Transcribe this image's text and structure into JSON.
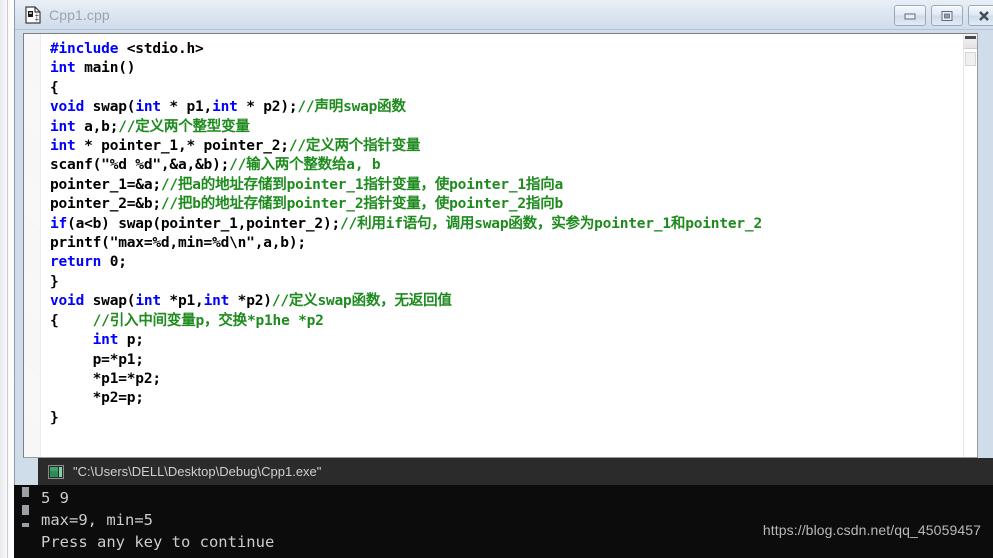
{
  "window": {
    "title": "Cpp1.cpp",
    "doc_icon": "cpp-file-icon",
    "buttons": {
      "minimize_label": "Minimize",
      "restore_label": "Restore",
      "close_label": "Close"
    }
  },
  "colors": {
    "keyword": "#0000ff",
    "comment": "#1e8b1e",
    "plain": "#000000",
    "title_bar_bg": "#dde7f1",
    "console_bg": "#0c0c0c",
    "console_title_bg": "#2b2b2b",
    "watermark": "#b9b9b9"
  },
  "editor": {
    "lines": [
      [
        {
          "t": "kw",
          "s": "#include"
        },
        {
          "t": "pl",
          "s": " <stdio.h>"
        }
      ],
      [
        {
          "t": "kw",
          "s": "int"
        },
        {
          "t": "pl",
          "s": " main()"
        }
      ],
      [
        {
          "t": "pl",
          "s": "{"
        }
      ],
      [
        {
          "t": "kw",
          "s": "void"
        },
        {
          "t": "pl",
          "s": " swap("
        },
        {
          "t": "kw",
          "s": "int"
        },
        {
          "t": "pl",
          "s": " * p1,"
        },
        {
          "t": "kw",
          "s": "int"
        },
        {
          "t": "pl",
          "s": " * p2);"
        },
        {
          "t": "cm",
          "s": "//声明swap函数"
        }
      ],
      [
        {
          "t": "kw",
          "s": "int"
        },
        {
          "t": "pl",
          "s": " a,b;"
        },
        {
          "t": "cm",
          "s": "//定义两个整型变量"
        }
      ],
      [
        {
          "t": "kw",
          "s": "int"
        },
        {
          "t": "pl",
          "s": " * pointer_1,* pointer_2;"
        },
        {
          "t": "cm",
          "s": "//定义两个指针变量"
        }
      ],
      [
        {
          "t": "pl",
          "s": "scanf(\"%d %d\",&a,&b);"
        },
        {
          "t": "cm",
          "s": "//输入两个整数给a, b"
        }
      ],
      [
        {
          "t": "pl",
          "s": "pointer_1=&a;"
        },
        {
          "t": "cm",
          "s": "//把a的地址存储到pointer_1指针变量，使pointer_1指向a"
        }
      ],
      [
        {
          "t": "pl",
          "s": "pointer_2=&b;"
        },
        {
          "t": "cm",
          "s": "//把b的地址存储到pointer_2指针变量，使pointer_2指向b"
        }
      ],
      [
        {
          "t": "kw",
          "s": "if"
        },
        {
          "t": "pl",
          "s": "(a<b) swap(pointer_1,pointer_2);"
        },
        {
          "t": "cm",
          "s": "//利用if语句，调用swap函数，实参为pointer_1和pointer_2"
        }
      ],
      [
        {
          "t": "pl",
          "s": "printf(\"max=%d,min=%d\\n\",a,b);"
        }
      ],
      [
        {
          "t": "kw",
          "s": "return"
        },
        {
          "t": "pl",
          "s": " 0;"
        }
      ],
      [
        {
          "t": "pl",
          "s": "}"
        }
      ],
      [
        {
          "t": "kw",
          "s": "void"
        },
        {
          "t": "pl",
          "s": " swap("
        },
        {
          "t": "kw",
          "s": "int"
        },
        {
          "t": "pl",
          "s": " *p1,"
        },
        {
          "t": "kw",
          "s": "int"
        },
        {
          "t": "pl",
          "s": " *p2)"
        },
        {
          "t": "cm",
          "s": "//定义swap函数，无返回值"
        }
      ],
      [
        {
          "t": "pl",
          "s": "{    "
        },
        {
          "t": "cm",
          "s": "//引入中间变量p，交换*p1he *p2"
        }
      ],
      [
        {
          "t": "pl",
          "s": "     "
        },
        {
          "t": "kw",
          "s": "int"
        },
        {
          "t": "pl",
          "s": " p;"
        }
      ],
      [
        {
          "t": "pl",
          "s": "     p=*p1;"
        }
      ],
      [
        {
          "t": "pl",
          "s": "     *p1=*p2;"
        }
      ],
      [
        {
          "t": "pl",
          "s": "     *p2=p;"
        }
      ],
      [
        {
          "t": "pl",
          "s": "}"
        }
      ]
    ]
  },
  "console": {
    "title": "\"C:\\Users\\DELL\\Desktop\\Debug\\Cpp1.exe\"",
    "icon": "console-monitor-icon",
    "output": [
      "5 9",
      "max=9, min=5",
      "Press any key to continue"
    ]
  },
  "watermark": {
    "text": "https://blog.csdn.net/qq_45059457"
  }
}
